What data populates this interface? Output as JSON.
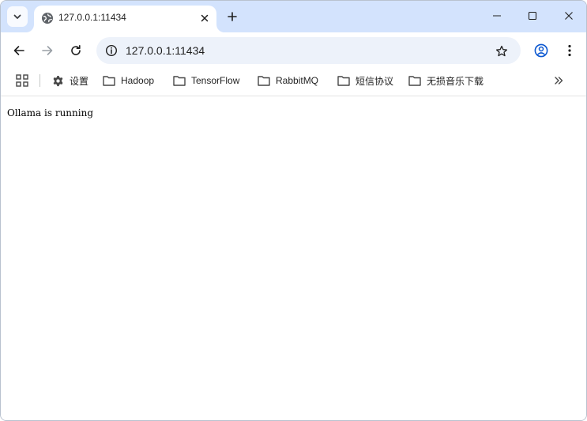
{
  "tab": {
    "title": "127.0.0.1:11434",
    "favicon": "globe-icon"
  },
  "toolbar": {
    "url": "127.0.0.1:11434",
    "back_icon": "back-arrow-icon",
    "forward_icon": "forward-arrow-icon",
    "reload_icon": "reload-icon",
    "site_info_icon": "site-info-icon",
    "bookmark_icon": "star-icon",
    "profile_icon": "profile-icon",
    "menu_icon": "kebab-menu-icon"
  },
  "bookmarks": {
    "items": [
      {
        "label": "设置",
        "icon": "gear-icon"
      },
      {
        "label": "Hadoop",
        "icon": "folder-icon"
      },
      {
        "label": "TensorFlow",
        "icon": "folder-icon"
      },
      {
        "label": "RabbitMQ",
        "icon": "folder-icon"
      },
      {
        "label": "短信协议",
        "icon": "folder-icon"
      },
      {
        "label": "无损音乐下载",
        "icon": "folder-icon"
      }
    ]
  },
  "page": {
    "body_text": "Ollama is running"
  },
  "colors": {
    "tab_strip": "#d3e3fd",
    "omnibox": "#edf2fa",
    "icon": "#474747"
  }
}
